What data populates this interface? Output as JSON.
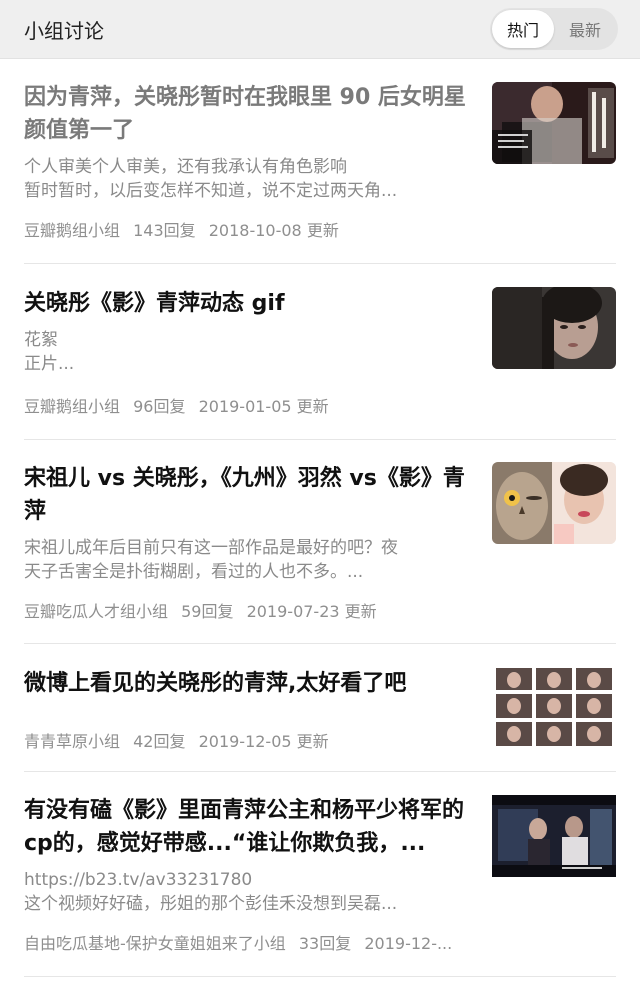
{
  "header": {
    "title": "小组讨论",
    "tabs": [
      {
        "label": "热门",
        "active": true
      },
      {
        "label": "最新",
        "active": false
      }
    ]
  },
  "items": [
    {
      "title": "因为青萍，关晓彤暂时在我眼里 90 后女明星颜值第一了",
      "snippet": [
        "个人审美个人审美，还有我承认有角色影响",
        "暂时暂时，以后变怎样不知道，说不定过两天角..."
      ],
      "group": "豆瓣鹅组小组",
      "replies": "143回复",
      "updated": "2018-10-08 更新",
      "thumb": "poster-collage"
    },
    {
      "title": "关晓彤《影》青萍动态 gif",
      "snippet": [
        "花絮",
        "正片..."
      ],
      "group": "豆瓣鹅组小组",
      "replies": "96回复",
      "updated": "2019-01-05 更新",
      "thumb": "portrait-dark"
    },
    {
      "title": "宋祖儿 vs 关晓彤，《九州》羽然 vs《影》青萍",
      "snippet": [
        "宋祖儿成年后目前只有这一部作品是最好的吧？夜",
        "天子舌害全是扑街糊剧，看过的人也不多。..."
      ],
      "group": "豆瓣吃瓜人才组小组",
      "replies": "59回复",
      "updated": "2019-07-23 更新",
      "thumb": "owl-and-girl"
    },
    {
      "title": "微博上看见的关晓彤的青萍,太好看了吧",
      "snippet": [],
      "group": "青青草原小组",
      "replies": "42回复",
      "updated": "2019-12-05 更新",
      "thumb": "photo-grid"
    },
    {
      "title": "有没有磕《影》里面青萍公主和杨平少将军的cp的，感觉好带感...“谁让你欺负我，...",
      "snippet": [
        "https://b23.tv/av33231780",
        "这个视频好好磕，彤姐的那个彭佳禾没想到吴磊..."
      ],
      "group": "自由吃瓜基地-保护女童姐姐来了小组",
      "replies": "33回复",
      "updated": "2019-12-...",
      "thumb": "video-still"
    }
  ]
}
